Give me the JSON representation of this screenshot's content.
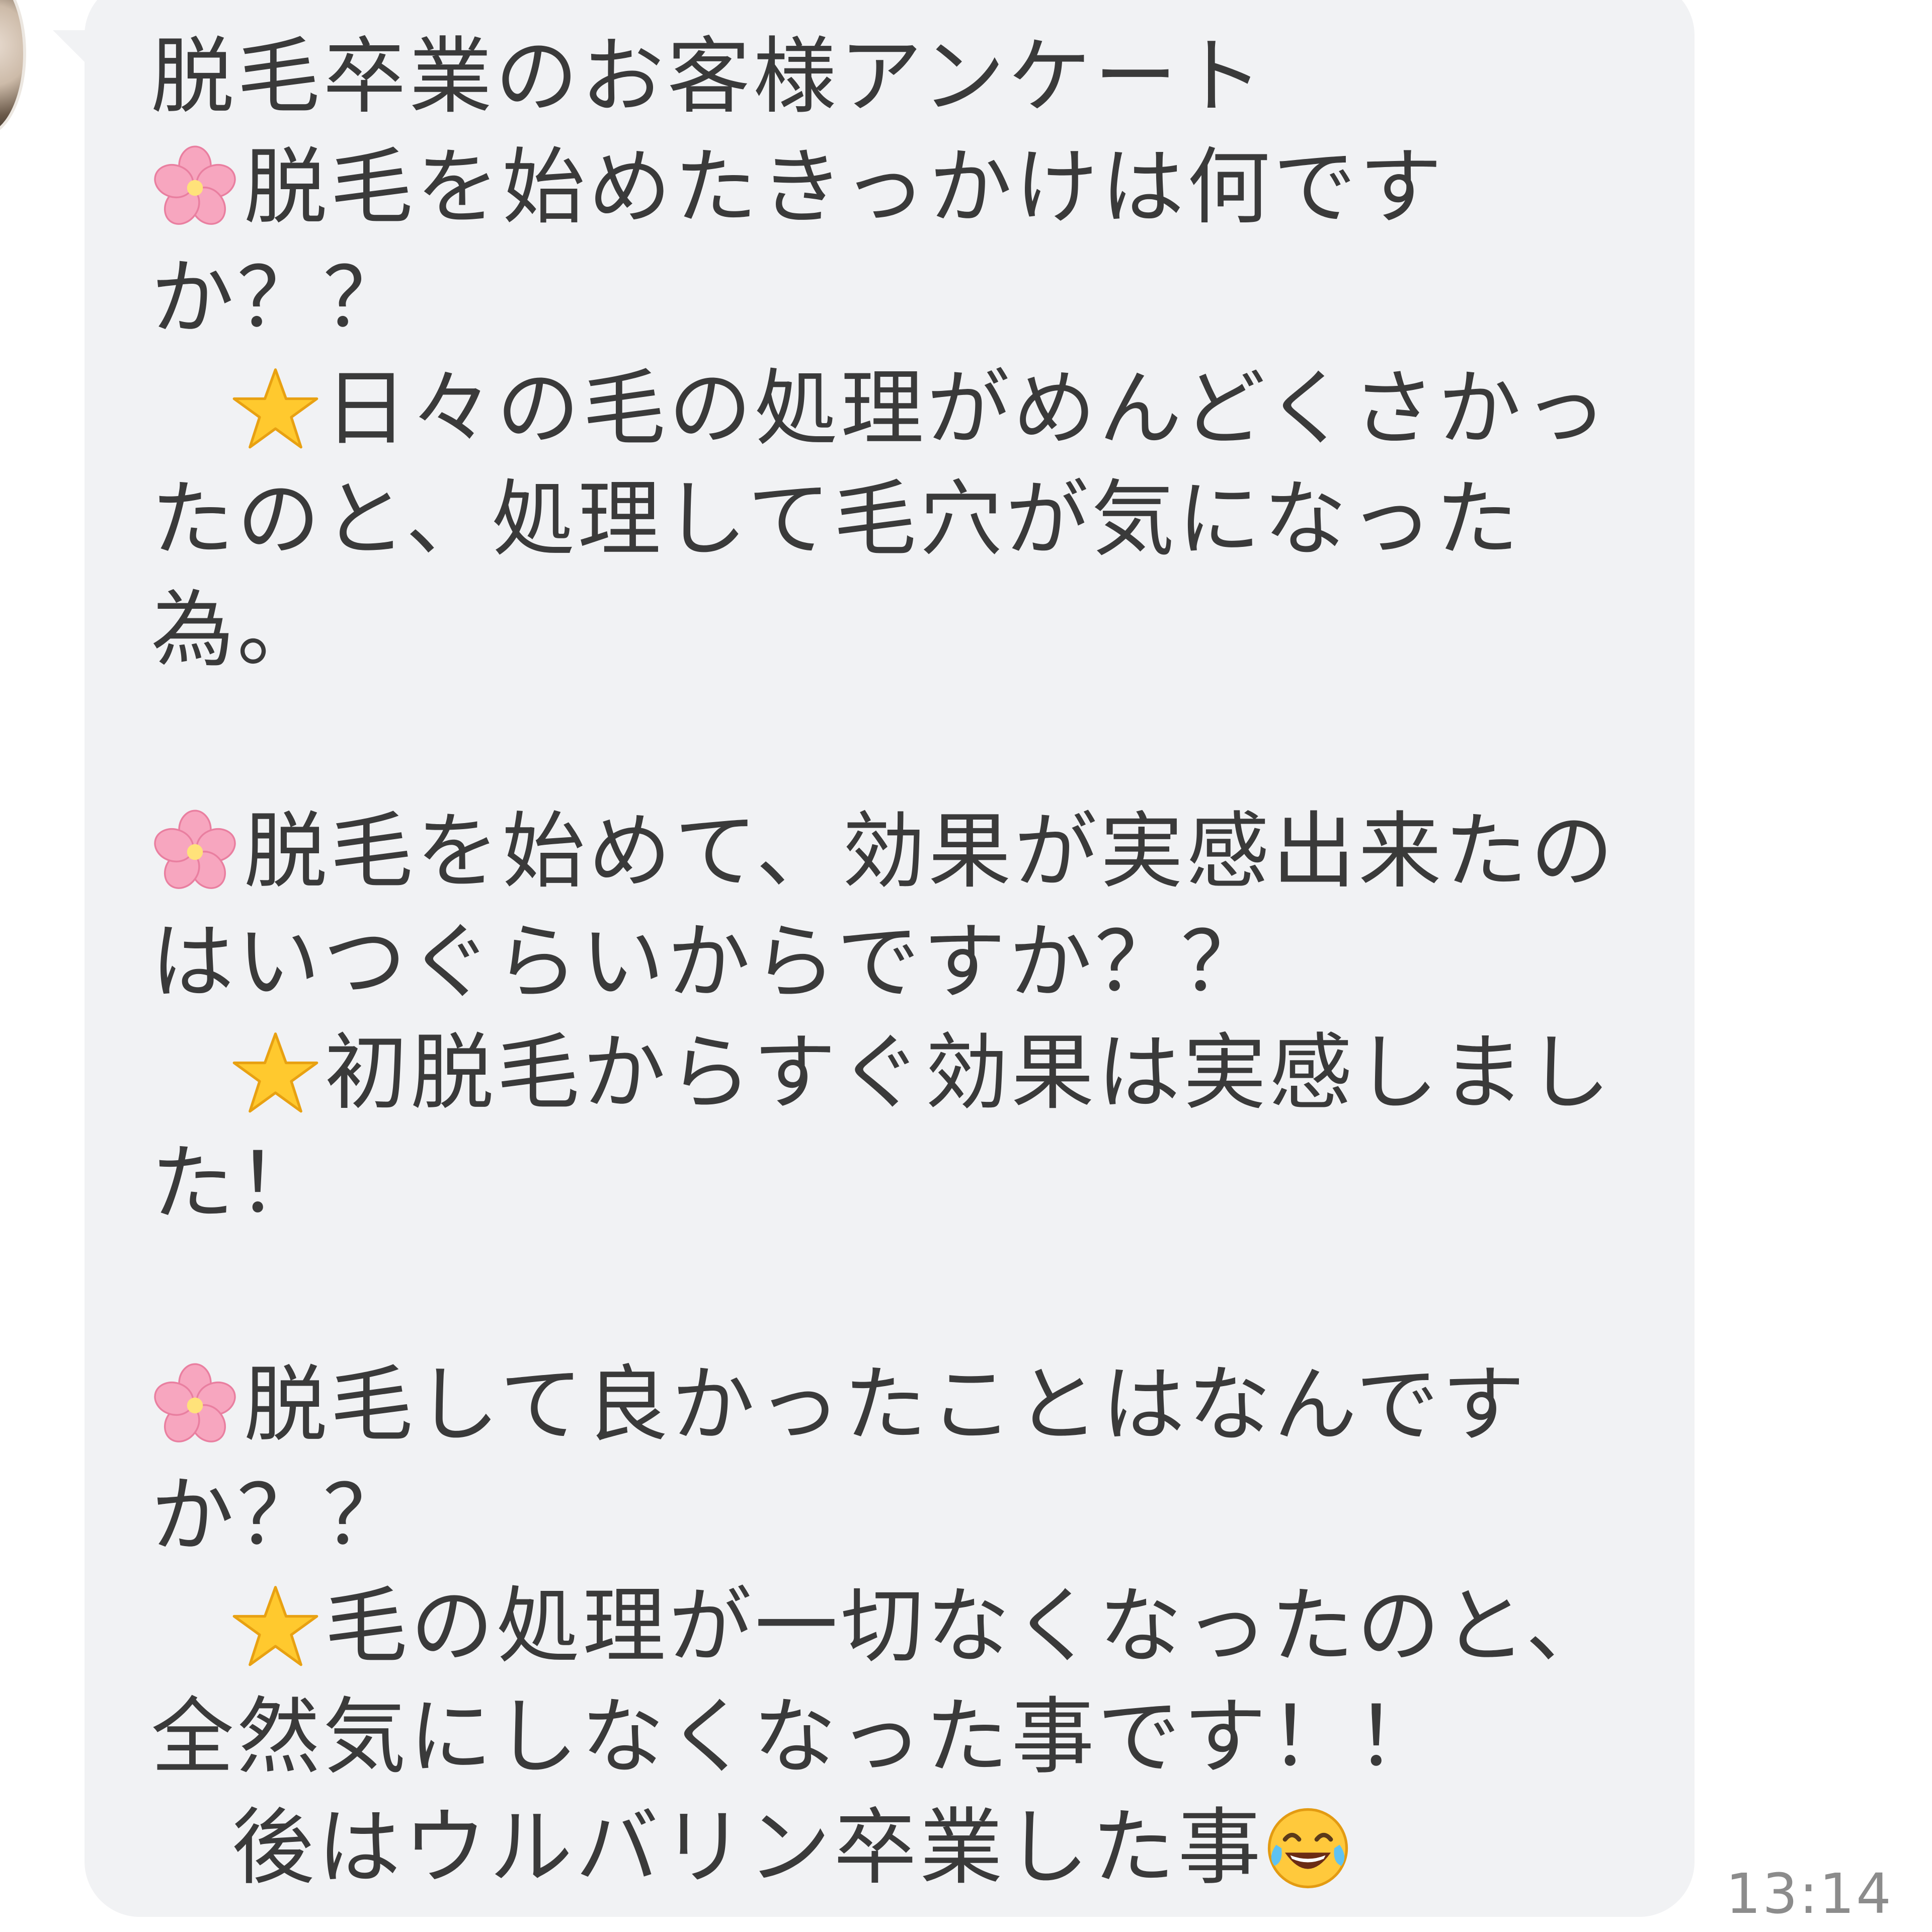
{
  "message": {
    "title": "脱毛卒業のお客様アンケート",
    "q1_line1": "脱毛を始めたきっかけは何です",
    "q1_line2": "か？？",
    "a1_line1": "日々の毛の処理がめんどくさかっ",
    "a1_line2": "たのと、処理して毛穴が気になった",
    "a1_line3": "為。",
    "q2_line1": "脱毛を始めて、効果が実感出来たの",
    "q2_line2": "はいつぐらいからですか？？",
    "a2_line1": "初脱毛からすぐ効果は実感しまし",
    "a2_line2": "た！",
    "q3_line1": "脱毛して良かったことはなんです",
    "q3_line2": "か？？",
    "a3_line1": "毛の処理が一切なくなったのと、",
    "a3_line2": "全然気にしなくなった事です！！",
    "a3_line3": "後はウルバリン卒業した事"
  },
  "timestamp": "13:14",
  "icons": {
    "question_marker": "cherry-blossom-icon",
    "answer_marker": "star-icon",
    "end_emoji": "laughing-tears-icon"
  },
  "colors": {
    "bubble": "#f1f2f4",
    "text": "#3a3a3a",
    "timestamp": "#8c8c8c",
    "blossom": "#f7a6bf",
    "star": "#ffc92e"
  }
}
